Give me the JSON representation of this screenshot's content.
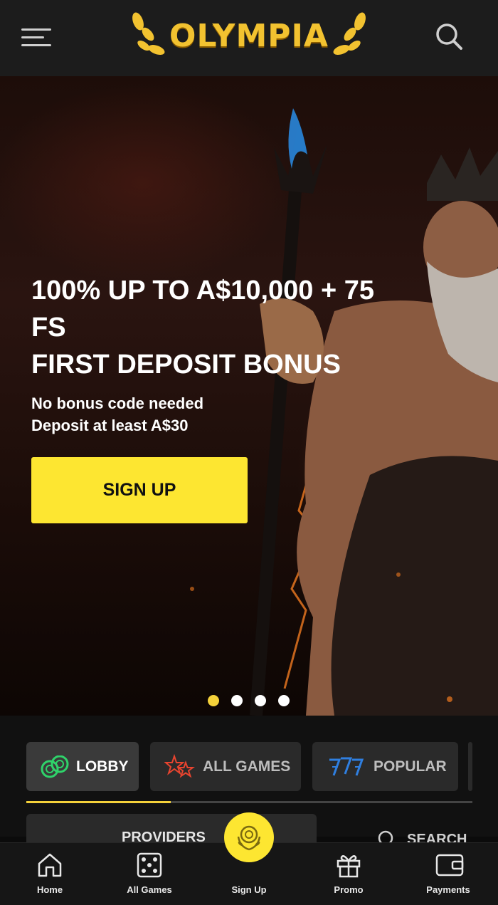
{
  "header": {
    "logo_text": "OLYMPIA",
    "menu_icon": "hamburger-menu-icon",
    "search_icon": "search-icon"
  },
  "hero": {
    "title_line1": "100% UP TO A$10,000 + 75",
    "title_line2": "FS",
    "title_line3": "FIRST DEPOSIT BONUS",
    "sub_line1": "No bonus code needed",
    "sub_line2": "Deposit at least A$30",
    "cta_label": "SIGN UP",
    "slides_total": 4,
    "active_slide": 1
  },
  "categories": {
    "tabs": [
      {
        "label": "LOBBY",
        "icon": "chips-icon",
        "active": true
      },
      {
        "label": "ALL GAMES",
        "icon": "stars-icon",
        "active": false
      },
      {
        "label": "POPULAR",
        "icon": "sevens-icon",
        "active": false
      }
    ],
    "providers_label": "PROVIDERS",
    "search_label": "SEARCH"
  },
  "bottom_nav": {
    "items": [
      {
        "label": "Home",
        "icon": "home-icon"
      },
      {
        "label": "All Games",
        "icon": "dice-icon"
      },
      {
        "label": "Sign Up",
        "icon": "laurel-coin-icon"
      },
      {
        "label": "Promo",
        "icon": "gift-icon"
      },
      {
        "label": "Payments",
        "icon": "wallet-icon"
      }
    ]
  },
  "colors": {
    "accent_yellow": "#fde631",
    "gold": "#f2c230",
    "header_bg": "#1c1c1c",
    "lobby_icon": "#2fd36a",
    "all_games_icon": "#e8442f",
    "popular_icon": "#2f7fe0"
  }
}
